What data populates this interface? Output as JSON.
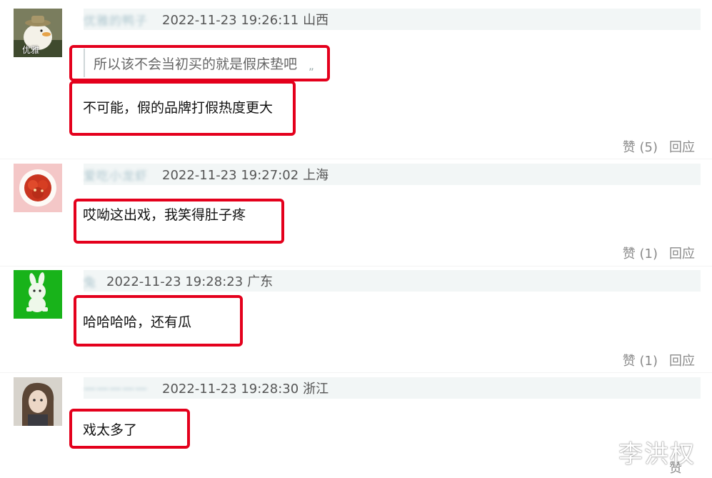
{
  "comments": [
    {
      "username": "优雅的鸭子",
      "timestamp": "2022-11-23 19:26:11",
      "location": "山西",
      "avatar_icon": "duck-with-hat-avatar",
      "avatar_label": "优雅",
      "quote": "所以该不会当初买的就是假床垫吧",
      "body": "不可能，假的品牌打假热度更大",
      "like_label": "赞",
      "like_count": "(5)",
      "reply_label": "回应"
    },
    {
      "username": "爱吃小龙虾",
      "timestamp": "2022-11-23 19:27:02",
      "location": "上海",
      "avatar_icon": "crayfish-plate-avatar",
      "body": "哎呦这出戏，我笑得肚子疼",
      "like_label": "赞",
      "like_count": "(1)",
      "reply_label": "回应"
    },
    {
      "username": "兔",
      "timestamp": "2022-11-23 19:28:23",
      "location": "广东",
      "avatar_icon": "green-rabbit-avatar",
      "body": "哈哈哈哈，还有瓜",
      "like_label": "赞",
      "like_count": "(1)",
      "reply_label": "回应"
    },
    {
      "username": "一一一一一",
      "timestamp": "2022-11-23 19:28:30",
      "location": "浙江",
      "avatar_icon": "doll-portrait-avatar",
      "body": "戏太多了",
      "like_label": "赞",
      "like_count": "",
      "reply_label": ""
    }
  ],
  "watermark": "李洪权",
  "colors": {
    "highlight_box": "#e4001c",
    "meta_bar": "#f2f6f6",
    "action_text": "#8a8a8a"
  }
}
